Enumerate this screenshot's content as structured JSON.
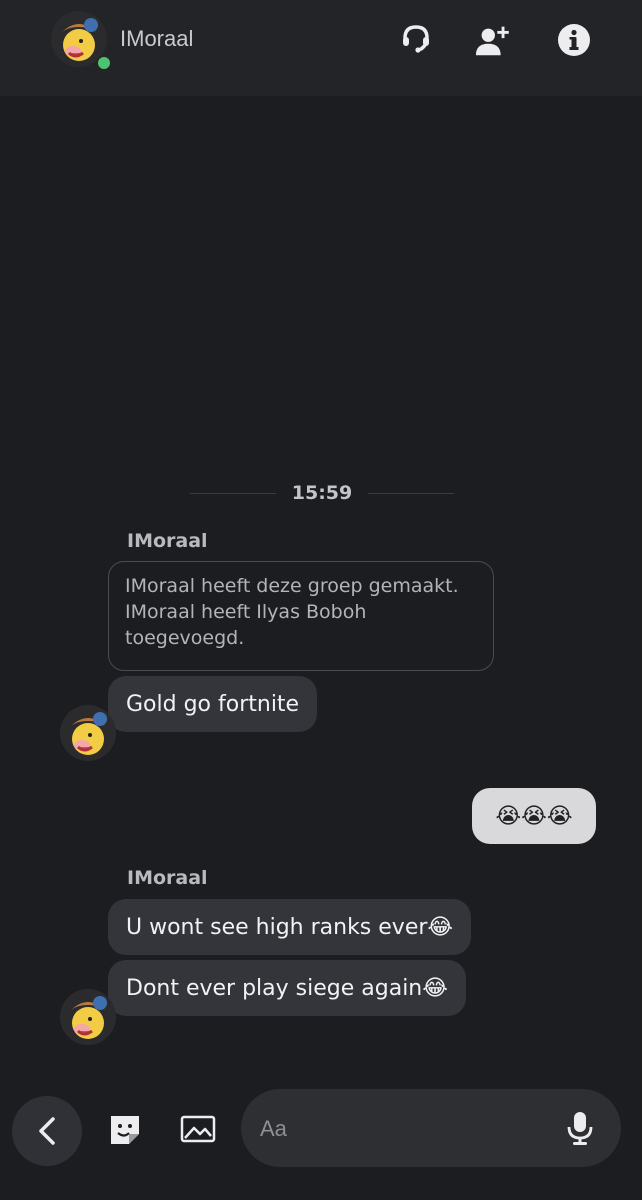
{
  "header": {
    "title": "IMoraal",
    "status": "online",
    "icons": [
      "headset-icon",
      "add-friend-icon",
      "info-icon"
    ]
  },
  "conversation": {
    "timestamp": "15:59",
    "groups": [
      {
        "sender": "IMoraal",
        "system_lines": [
          "IMoraal heeft deze groep gemaakt.",
          "IMoraal heeft Ilyas Boboh",
          "toegevoegd."
        ],
        "messages": [
          "Gold go fortnite"
        ]
      },
      {
        "sender": "me",
        "messages": [
          "😭😭😭"
        ]
      },
      {
        "sender": "IMoraal",
        "messages": [
          {
            "text": "U wont see high ranks ever",
            "emoji": "😂"
          },
          {
            "text": "Dont ever play siege again",
            "emoji": "😂"
          }
        ]
      }
    ]
  },
  "composer": {
    "placeholder": "Aa",
    "icons": [
      "back-chevron-icon",
      "sticker-icon",
      "image-icon",
      "microphone-icon"
    ]
  },
  "colors": {
    "background": "#1c1d20",
    "header": "#232427",
    "bubble_incoming": "#34353a",
    "bubble_outgoing": "#d9d9dc",
    "online": "#4ec36e"
  }
}
